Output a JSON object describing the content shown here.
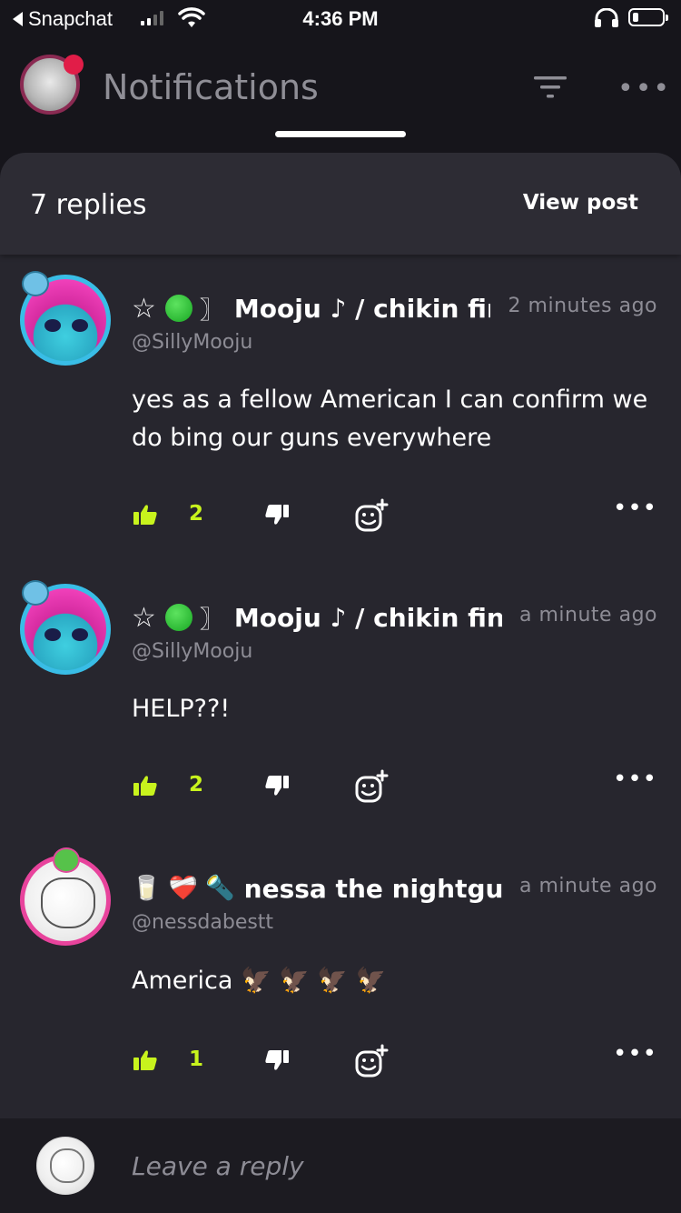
{
  "status_bar": {
    "back_app": "Snapchat",
    "time": "4:36 PM"
  },
  "header": {
    "title": "Notifications"
  },
  "sheet": {
    "replies_count": "7 replies",
    "view_post_label": "View post"
  },
  "comments": [
    {
      "deco_star": "☆",
      "bracket": "〗",
      "name": "Mooju ♪ / chikin fing",
      "timestamp": "2 minutes ago",
      "handle": "@SillyMooju",
      "text": "yes as a fellow American I can confirm we do bing our guns everywhere",
      "likes": "2"
    },
    {
      "deco_star": "☆",
      "bracket": "〗",
      "name": "Mooju ♪ / chikin finge",
      "timestamp": "a minute ago",
      "handle": "@SillyMooju",
      "text": "HELP??!",
      "likes": "2"
    },
    {
      "emojis": "🥛 ❤️‍🩹 🔦",
      "name": "nessa the nightguarc",
      "timestamp": "a minute ago",
      "handle": "@nessdabestt",
      "text": "America 🦅 🦅 🦅 🦅",
      "likes": "1"
    }
  ],
  "reply_bar": {
    "placeholder": "Leave a reply"
  },
  "colors": {
    "background": "#16151b",
    "sheet": "#27262e",
    "accent_like": "#c8f31d",
    "muted_text": "#8d8c95"
  }
}
